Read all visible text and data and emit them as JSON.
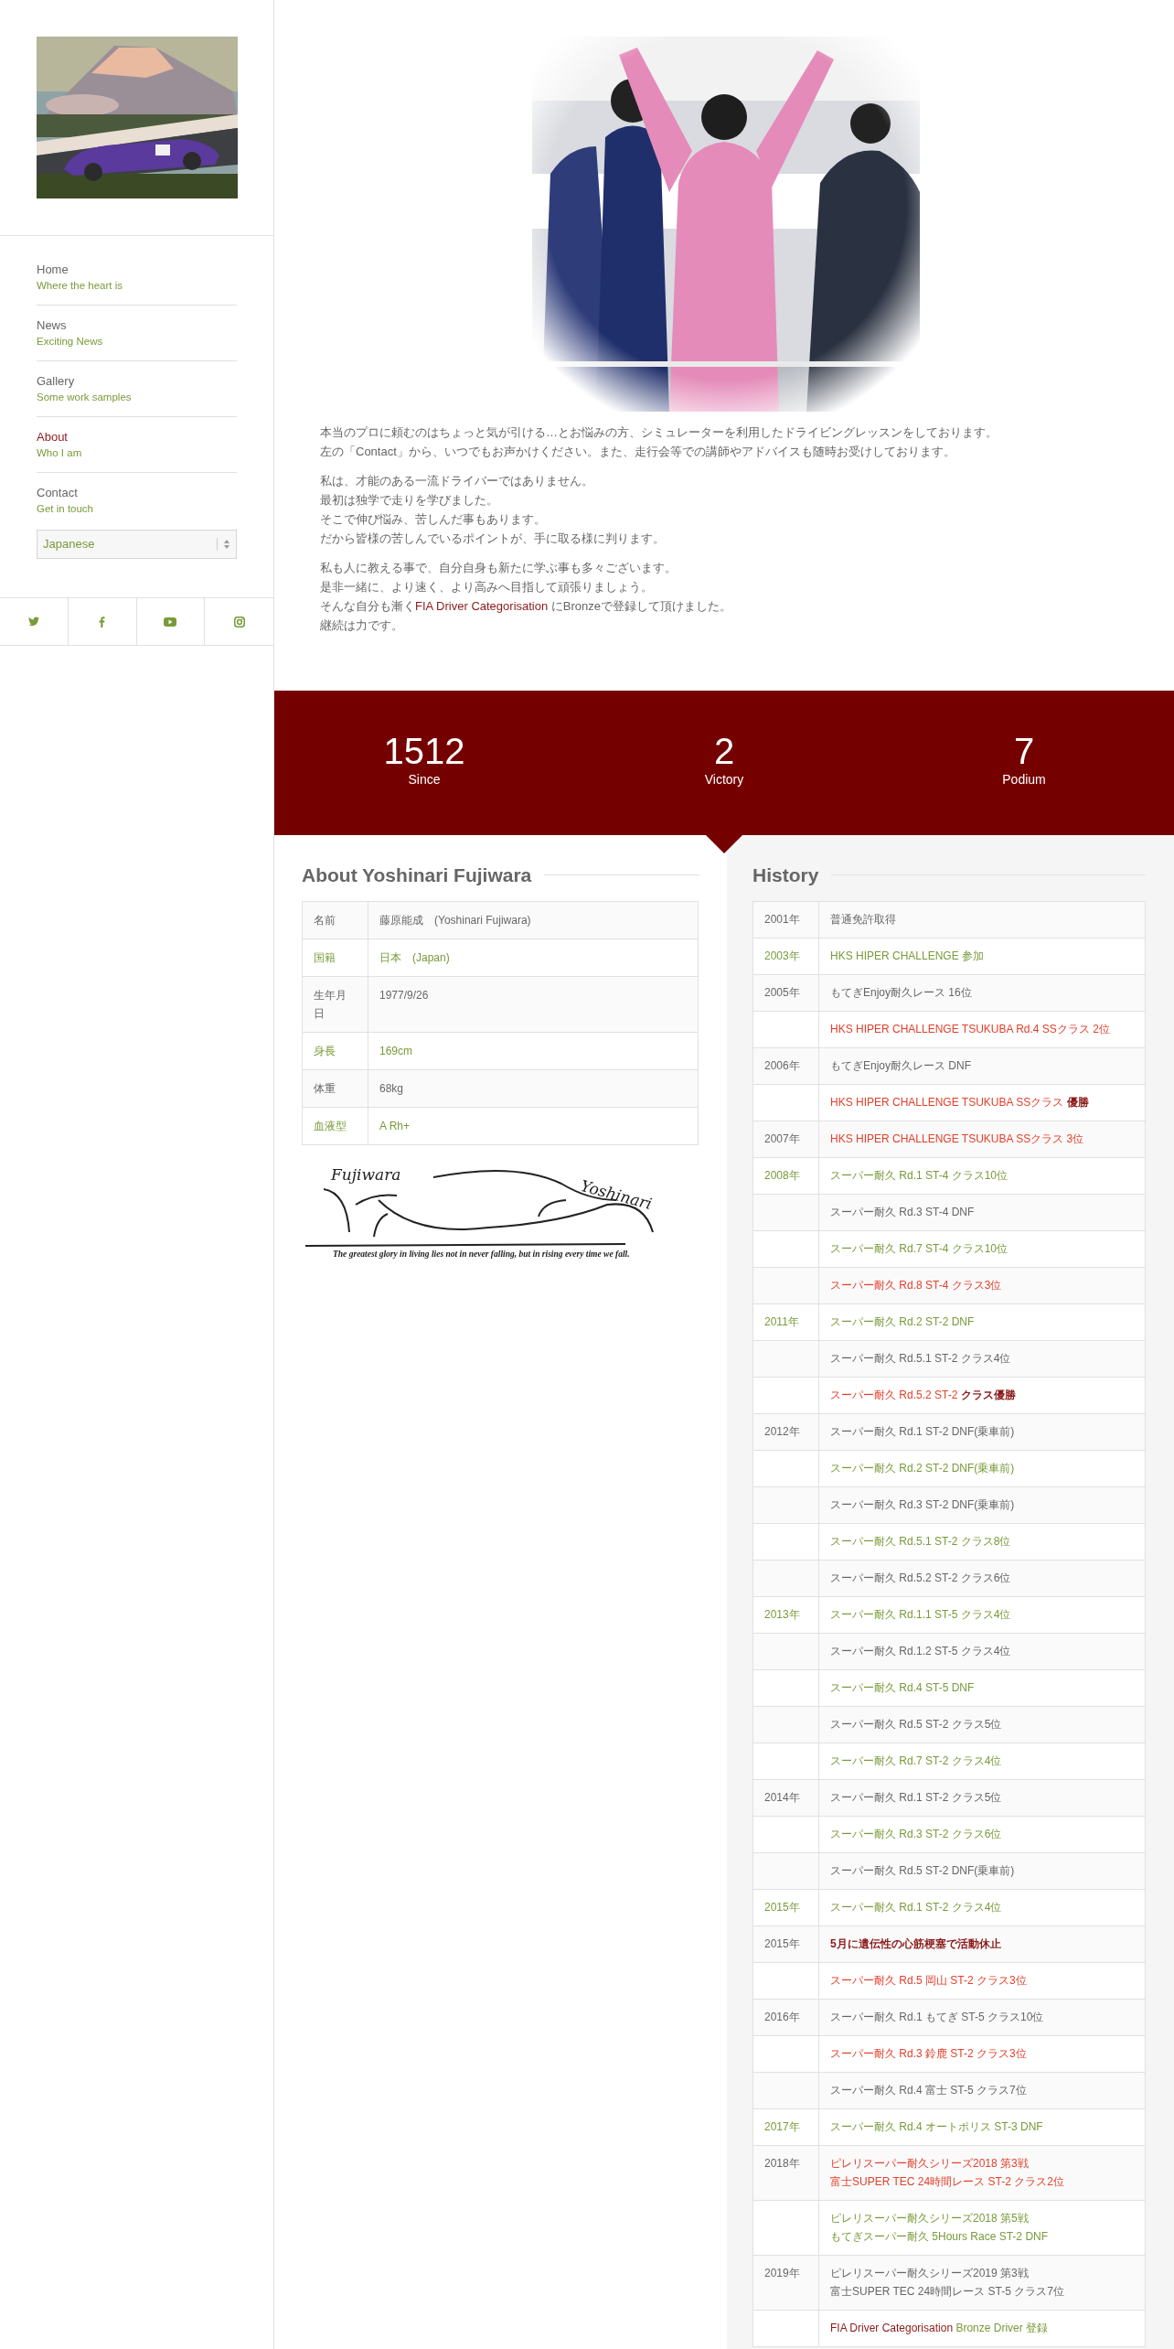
{
  "sidebar": {
    "nav": [
      {
        "title": "Home",
        "subtitle": "Where the heart is",
        "selected": false
      },
      {
        "title": "News",
        "subtitle": "Exciting News",
        "selected": false
      },
      {
        "title": "Gallery",
        "subtitle": "Some work samples",
        "selected": false
      },
      {
        "title": "About",
        "subtitle": "Who I am",
        "selected": true
      },
      {
        "title": "Contact",
        "subtitle": "Get in touch",
        "selected": false
      }
    ],
    "language": {
      "value": "Japanese"
    }
  },
  "intro": [
    {
      "lines": [
        "本当のプロに頼むのはちょっと気が引ける…とお悩みの方、シミュレーターを利用したドライビングレッスンをしております。",
        "左の「Contact」から、いつでもお声かけください。また、走行会等での講師やアドバイスも随時お受けしております。"
      ]
    },
    {
      "lines": [
        "私は、才能のある一流ドライバーではありません。",
        "最初は独学で走りを学びました。",
        "そこで伸び悩み、苦しんだ事もあります。",
        "だから皆様の苦しんでいるポイントが、手に取る様に判ります。"
      ]
    },
    {
      "lines": [
        "私も人に教える事で、自分自身も新たに学ぶ事も多々ございます。",
        "是非一緒に、より速く、より高みへ目指して頑張りましょう。",
        {
          "before": "そんな自分も漸く",
          "link": "FIA Driver Categorisation",
          "after": " にBronzeで登録して頂けました。"
        },
        "継続は力です。"
      ]
    }
  ],
  "stats": [
    {
      "value": "1512",
      "label": "Since"
    },
    {
      "value": "2",
      "label": "Victory"
    },
    {
      "value": "7",
      "label": "Podium"
    }
  ],
  "about": {
    "title": "About Yoshinari Fujiwara",
    "rows": [
      {
        "label": "名前",
        "value": "藤原能成　(Yoshinari Fujiwara)",
        "kind": "plain"
      },
      {
        "label": "国籍",
        "value": "日本　(Japan)",
        "kind": "accent"
      },
      {
        "label": "生年月日",
        "value": "1977/9/26",
        "kind": "plain"
      },
      {
        "label": "身長",
        "value": "169cm",
        "kind": "accent"
      },
      {
        "label": "体重",
        "value": "68kg",
        "kind": "plain"
      },
      {
        "label": "血液型",
        "value": "A Rh+",
        "kind": "accent"
      }
    ],
    "signature": {
      "first": "Fujiwara",
      "second": "Yoshinari",
      "quote": "The greatest glory in living lies not in never falling, but in rising every time we fall."
    }
  },
  "history": {
    "title": "History",
    "rows": [
      {
        "year": "2001年",
        "lines": [
          "普通免許取得"
        ],
        "kind": "plain"
      },
      {
        "year": "2003年",
        "lines": [
          "HKS HIPER CHALLENGE 参加"
        ],
        "kind": "green"
      },
      {
        "year": "2005年",
        "lines": [
          "もてぎEnjoy耐久レース 16位"
        ],
        "kind": "plain"
      },
      {
        "lines": [
          "HKS HIPER CHALLENGE TSUKUBA Rd.4 SSクラス 2位"
        ],
        "kind": "red"
      },
      {
        "year": "2006年",
        "lines": [
          "もてぎEnjoy耐久レース DNF"
        ],
        "kind": "plain"
      },
      {
        "lines": [
          "HKS HIPER CHALLENGE TSUKUBA SSクラス **優勝**"
        ],
        "kind": "red"
      },
      {
        "year": "2007年",
        "lines": [
          "HKS HIPER CHALLENGE TSUKUBA SSクラス 3位"
        ],
        "kind": "red"
      },
      {
        "year": "2008年",
        "lines": [
          "スーパー耐久 Rd.1 ST-4 クラス10位"
        ],
        "kind": "green"
      },
      {
        "lines": [
          "スーパー耐久 Rd.3 ST-4 DNF"
        ],
        "kind": "plain"
      },
      {
        "lines": [
          "スーパー耐久 Rd.7 ST-4 クラス10位"
        ],
        "kind": "green"
      },
      {
        "lines": [
          "スーパー耐久 Rd.8 ST-4 クラス3位"
        ],
        "kind": "red"
      },
      {
        "year": "2011年",
        "lines": [
          "スーパー耐久 Rd.2 ST-2 DNF"
        ],
        "kind": "green"
      },
      {
        "lines": [
          "スーパー耐久 Rd.5.1 ST-2 クラス4位"
        ],
        "kind": "plain"
      },
      {
        "lines": [
          "スーパー耐久 Rd.5.2 ST-2 **クラス優勝**"
        ],
        "kind": "red"
      },
      {
        "year": "2012年",
        "lines": [
          "スーパー耐久 Rd.1 ST-2 DNF(乗車前)"
        ],
        "kind": "plain"
      },
      {
        "lines": [
          "スーパー耐久 Rd.2 ST-2 DNF(乗車前)"
        ],
        "kind": "green"
      },
      {
        "lines": [
          "スーパー耐久 Rd.3 ST-2 DNF(乗車前)"
        ],
        "kind": "plain"
      },
      {
        "lines": [
          "スーパー耐久 Rd.5.1 ST-2 クラス8位"
        ],
        "kind": "green"
      },
      {
        "lines": [
          "スーパー耐久 Rd.5.2 ST-2 クラス6位"
        ],
        "kind": "plain"
      },
      {
        "year": "2013年",
        "lines": [
          "スーパー耐久 Rd.1.1 ST-5 クラス4位"
        ],
        "kind": "green"
      },
      {
        "lines": [
          "スーパー耐久 Rd.1.2 ST-5 クラス4位"
        ],
        "kind": "plain"
      },
      {
        "lines": [
          "スーパー耐久 Rd.4 ST-5 DNF"
        ],
        "kind": "green"
      },
      {
        "lines": [
          "スーパー耐久 Rd.5 ST-2 クラス5位"
        ],
        "kind": "plain"
      },
      {
        "lines": [
          "スーパー耐久 Rd.7 ST-2 クラス4位"
        ],
        "kind": "green"
      },
      {
        "year": "2014年",
        "lines": [
          "スーパー耐久 Rd.1 ST-2 クラス5位"
        ],
        "kind": "plain"
      },
      {
        "lines": [
          "スーパー耐久 Rd.3 ST-2 クラス6位"
        ],
        "kind": "green"
      },
      {
        "lines": [
          "スーパー耐久 Rd.5 ST-2 DNF(乗車前)"
        ],
        "kind": "plain"
      },
      {
        "year": "2015年",
        "lines": [
          "スーパー耐久 Rd.1 ST-2 クラス4位"
        ],
        "kind": "green"
      },
      {
        "year": "2015年",
        "lines": [
          "5月に遺伝性の心筋梗塞で活動休止"
        ],
        "kind": "alert"
      },
      {
        "lines": [
          "スーパー耐久 Rd.5 岡山 ST-2 クラス3位"
        ],
        "kind": "red"
      },
      {
        "year": "2016年",
        "lines": [
          "スーパー耐久 Rd.1 もてぎ ST-5 クラス10位"
        ],
        "kind": "plain"
      },
      {
        "lines": [
          "スーパー耐久 Rd.3 鈴鹿 ST-2 クラス3位"
        ],
        "kind": "red"
      },
      {
        "lines": [
          "スーパー耐久 Rd.4 富士 ST-5 クラス7位"
        ],
        "kind": "plain"
      },
      {
        "year": "2017年",
        "lines": [
          "スーパー耐久 Rd.4 オートポリス ST-3 DNF"
        ],
        "kind": "green"
      },
      {
        "year": "2018年",
        "lines": [
          "ピレリスーパー耐久シリーズ2018 第3戦",
          "富士SUPER TEC 24時間レース ST-2 クラス2位"
        ],
        "kind": "red"
      },
      {
        "lines": [
          "ピレリスーパー耐久シリーズ2018 第5戦",
          "もてぎスーパー耐久 5Hours Race ST-2 DNF"
        ],
        "kind": "green"
      },
      {
        "year": "2019年",
        "lines": [
          "ピレリスーパー耐久シリーズ2019 第3戦",
          "富士SUPER TEC 24時間レース ST-5 クラス7位"
        ],
        "kind": "plain"
      },
      {
        "link": "FIA Driver Categorisation",
        "lines": [
          "Bronze Driver 登録"
        ],
        "kind": "green"
      }
    ]
  }
}
